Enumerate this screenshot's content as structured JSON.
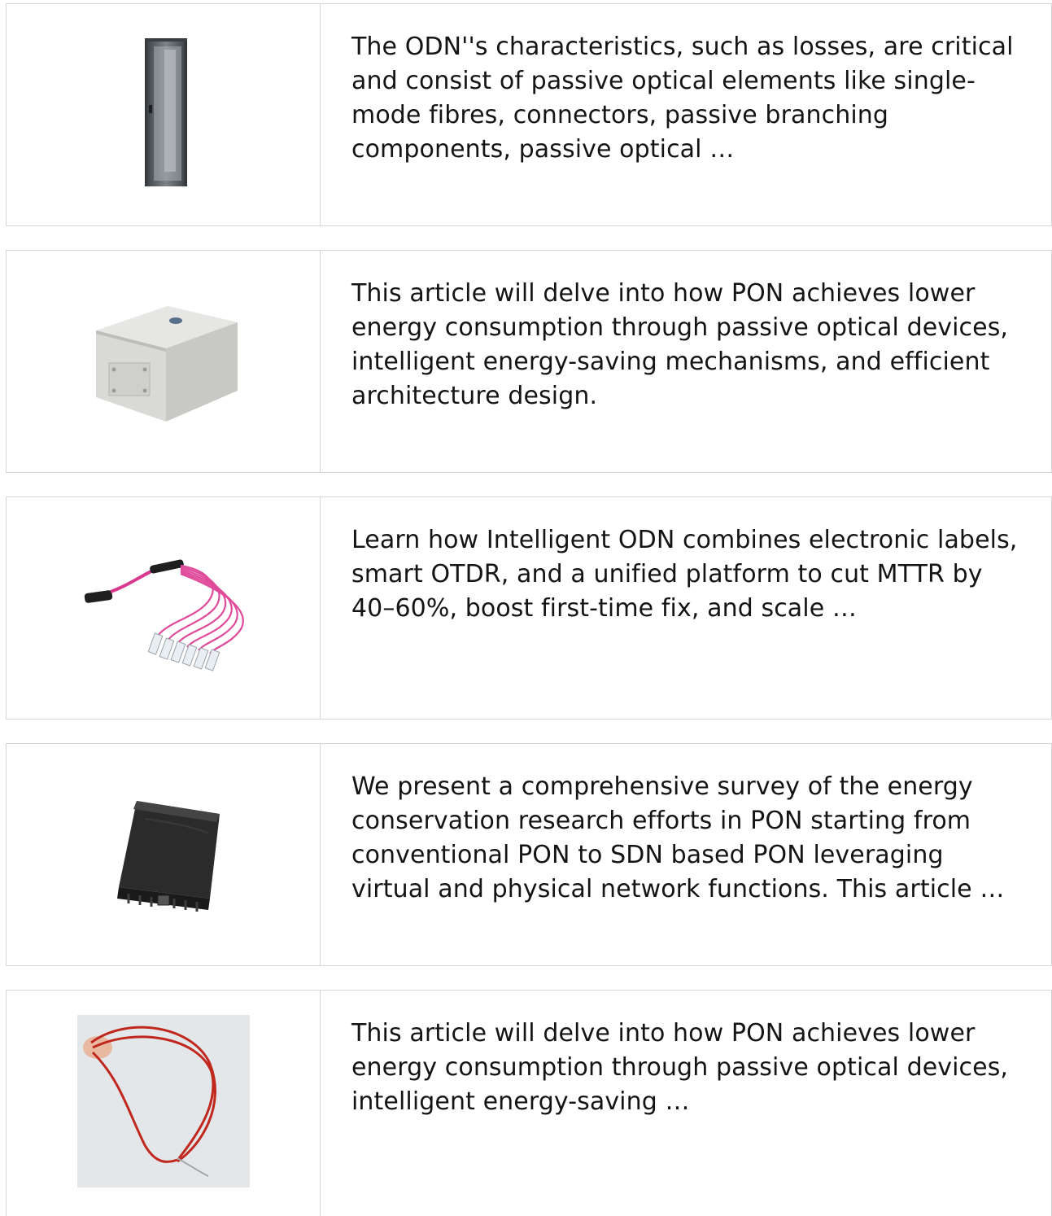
{
  "articles": [
    {
      "image_icon": "network-cabinet-image",
      "excerpt": "The ODN''s characteristics, such as losses, are critical and consist of passive optical elements like single-mode fibres, connectors, passive branching components, passive optical …"
    },
    {
      "image_icon": "distribution-box-image",
      "excerpt": "This article will delve into how PON achieves lower energy consumption through passive optical devices, intelligent energy-saving mechanisms, and efficient architecture design."
    },
    {
      "image_icon": "fiber-fanout-cable-image",
      "excerpt": "Learn how Intelligent ODN combines electronic labels, smart OTDR, and a unified platform to cut MTTR by 40–60%, boost first-time fix, and scale …"
    },
    {
      "image_icon": "splice-closure-image",
      "excerpt": "We present a comprehensive survey of the energy conservation research efforts in PON starting from conventional PON to SDN based PON leveraging virtual and physical network functions. This article …"
    },
    {
      "image_icon": "red-fiber-cable-image",
      "excerpt": "This article will delve into how PON achieves lower energy consumption through passive optical devices, intelligent energy-saving …"
    }
  ]
}
